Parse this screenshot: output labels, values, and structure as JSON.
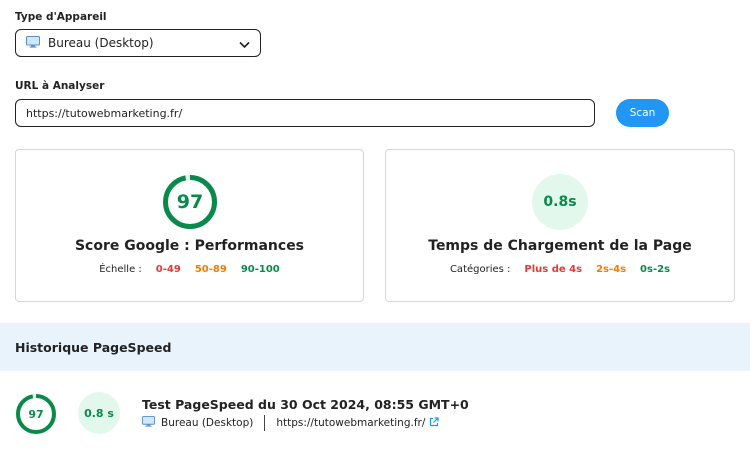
{
  "device": {
    "label": "Type d'Appareil",
    "selected": "Bureau (Desktop)"
  },
  "url": {
    "label": "URL à Analyser",
    "value": "https://tutowebmarketing.fr/"
  },
  "scan_label": "Scan",
  "score_card": {
    "score": "97",
    "score_fraction": 0.97,
    "title": "Score Google : Performances",
    "scale_label": "Échelle :",
    "ranges": [
      "0-49",
      "50-89",
      "90-100"
    ]
  },
  "time_card": {
    "time": "0.8s",
    "title": "Temps de Chargement de la Page",
    "categories_label": "Catégories :",
    "categories": [
      "Plus de 4s",
      "2s-4s",
      "0s-2s"
    ]
  },
  "history": {
    "title": "Historique PageSpeed",
    "entries": [
      {
        "score": "97",
        "score_fraction": 0.97,
        "time": "0.8 s",
        "title": "Test PageSpeed du 30 Oct 2024, 08:55 GMT+0",
        "device": "Bureau (Desktop)",
        "url": "https://tutowebmarketing.fr/"
      }
    ]
  },
  "colors": {
    "accent": "#2196f3",
    "good": "#0a8a4a",
    "medium": "#f57c00",
    "bad": "#e53935",
    "history_bg": "#e8f3fc"
  },
  "icons": [
    "desktop-icon",
    "chevron-down-icon",
    "external-link-icon"
  ]
}
